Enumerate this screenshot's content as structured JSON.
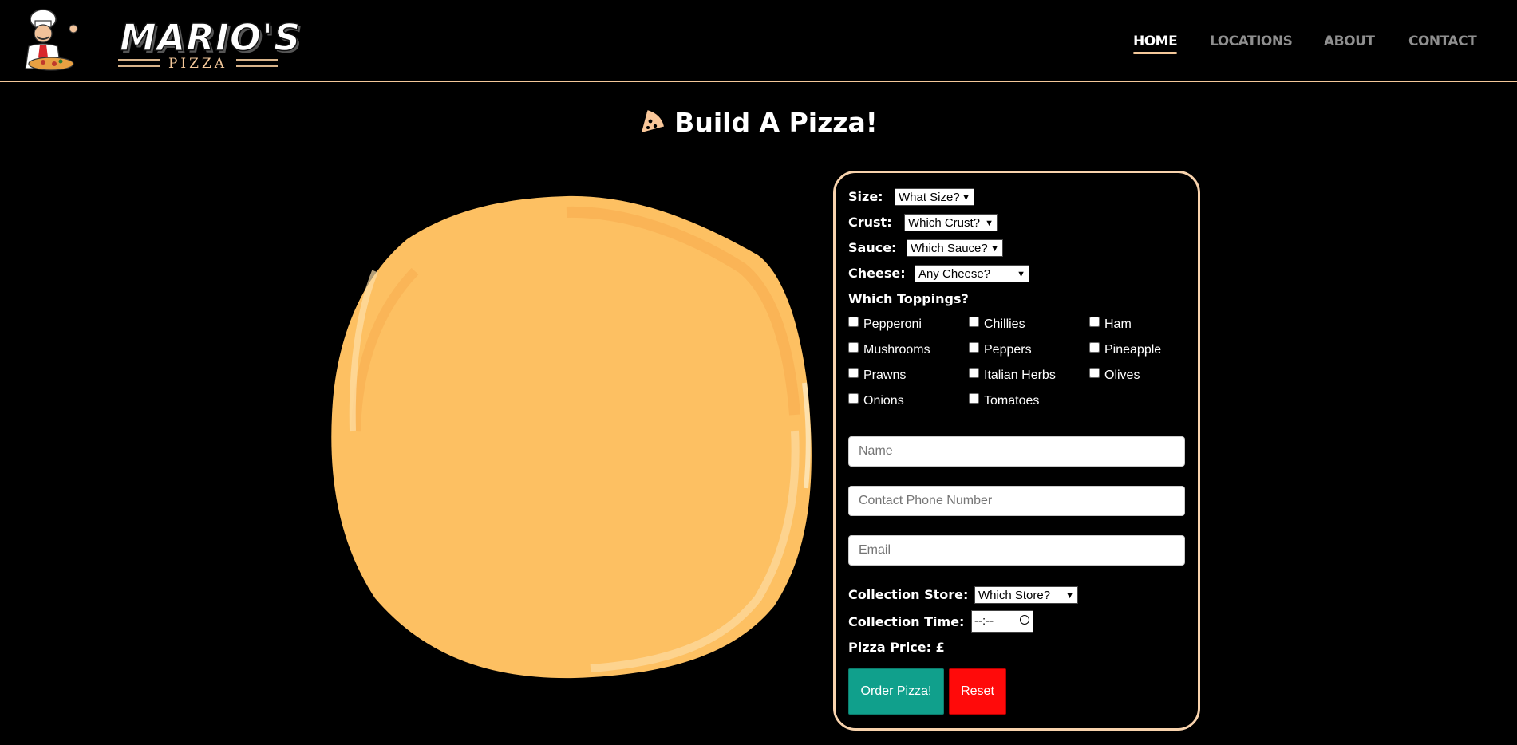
{
  "brand": {
    "name": "MARIO'S",
    "sub": "PIZZA"
  },
  "nav": {
    "home": "HOME",
    "locations": "LOCATIONS",
    "about": "ABOUT",
    "contact": "CONTACT"
  },
  "page_title": "Build A Pizza!",
  "form": {
    "size_label": "Size:",
    "size_value": "What Size?",
    "crust_label": "Crust:",
    "crust_value": "Which Crust?",
    "sauce_label": "Sauce:",
    "sauce_value": "Which Sauce?",
    "cheese_label": "Cheese:",
    "cheese_value": "Any Cheese?",
    "toppings_label": "Which Toppings?",
    "toppings": [
      "Pepperoni",
      "Chillies",
      "Ham",
      "Mushrooms",
      "Peppers",
      "Pineapple",
      "Prawns",
      "Italian Herbs",
      "Olives",
      "Onions",
      "Tomatoes"
    ],
    "name_placeholder": "Name",
    "phone_placeholder": "Contact Phone Number",
    "email_placeholder": "Email",
    "store_label": "Collection Store:",
    "store_value": "Which Store?",
    "time_label": "Collection Time:",
    "time_value": "--:--",
    "price_label": "Pizza Price: £",
    "order_button": "Order Pizza!",
    "reset_button": "Reset"
  },
  "colors": {
    "accent": "#f4c89a",
    "order": "#10a08c",
    "reset": "#ff0a0a",
    "dough": "#fdc062"
  }
}
